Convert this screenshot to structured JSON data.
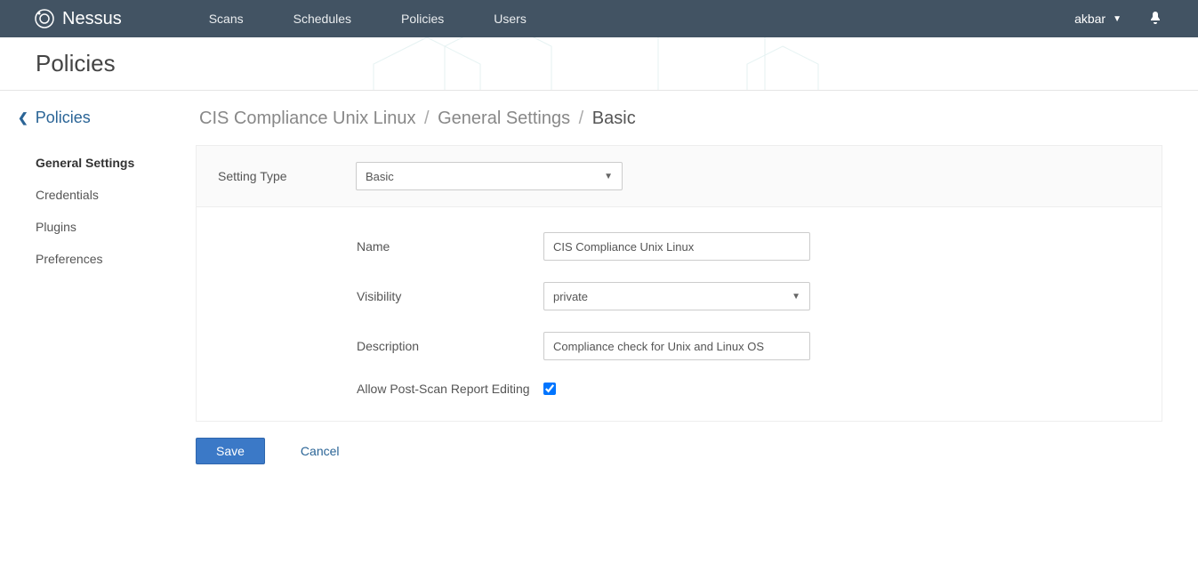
{
  "brand": "Nessus",
  "nav": {
    "scans": "Scans",
    "schedules": "Schedules",
    "policies": "Policies",
    "users": "Users"
  },
  "user": {
    "name": "akbar"
  },
  "page": {
    "title": "Policies"
  },
  "sidebar": {
    "back_label": "Policies",
    "items": [
      {
        "label": "General Settings"
      },
      {
        "label": "Credentials"
      },
      {
        "label": "Plugins"
      },
      {
        "label": "Preferences"
      }
    ]
  },
  "breadcrumb": {
    "policy_name": "CIS Compliance Unix Linux",
    "section": "General Settings",
    "sub": "Basic"
  },
  "form": {
    "setting_type_label": "Setting Type",
    "setting_type_value": "Basic",
    "name_label": "Name",
    "name_value": "CIS Compliance Unix Linux",
    "visibility_label": "Visibility",
    "visibility_value": "private",
    "description_label": "Description",
    "description_value": "Compliance check for Unix and Linux OS",
    "allow_post_label": "Allow Post-Scan Report Editing",
    "allow_post_checked": true
  },
  "actions": {
    "save": "Save",
    "cancel": "Cancel"
  }
}
